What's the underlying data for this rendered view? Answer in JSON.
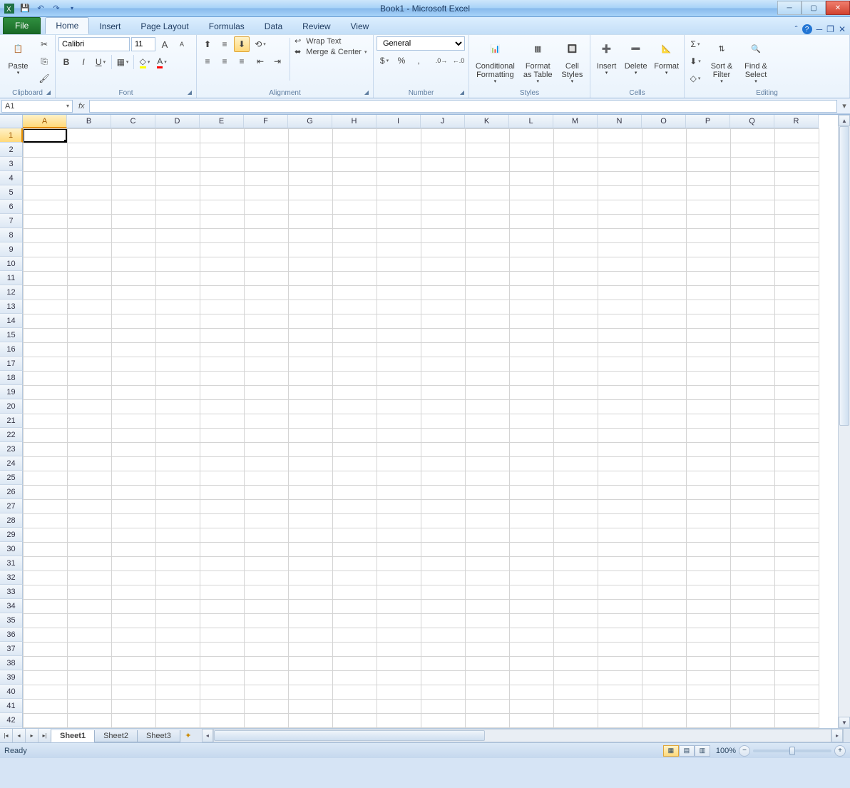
{
  "title": "Book1 - Microsoft Excel",
  "tabs": {
    "file": "File",
    "home": "Home",
    "insert": "Insert",
    "pagelayout": "Page Layout",
    "formulas": "Formulas",
    "data": "Data",
    "review": "Review",
    "view": "View"
  },
  "ribbon": {
    "clipboard": {
      "paste": "Paste",
      "label": "Clipboard"
    },
    "font": {
      "name": "Calibri",
      "size": "11",
      "label": "Font"
    },
    "alignment": {
      "wrap": "Wrap Text",
      "merge": "Merge & Center",
      "label": "Alignment"
    },
    "number": {
      "format": "General",
      "label": "Number"
    },
    "styles": {
      "cond": "Conditional Formatting",
      "table": "Format as Table",
      "cell": "Cell Styles",
      "label": "Styles"
    },
    "cells": {
      "insert": "Insert",
      "delete": "Delete",
      "format": "Format",
      "label": "Cells"
    },
    "editing": {
      "sort": "Sort & Filter",
      "find": "Find & Select",
      "label": "Editing"
    }
  },
  "nameBox": "A1",
  "columns": [
    "A",
    "B",
    "C",
    "D",
    "E",
    "F",
    "G",
    "H",
    "I",
    "J",
    "K",
    "L",
    "M",
    "N",
    "O",
    "P",
    "Q",
    "R"
  ],
  "rowCount": 43,
  "sheets": [
    "Sheet1",
    "Sheet2",
    "Sheet3"
  ],
  "status": {
    "ready": "Ready",
    "zoom": "100%"
  }
}
